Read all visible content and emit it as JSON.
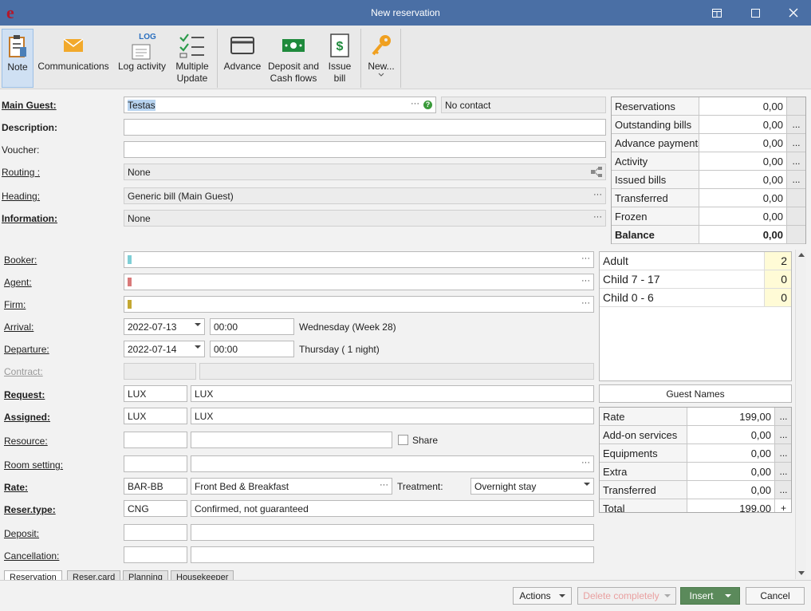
{
  "window": {
    "logo": "e",
    "title": "New reservation"
  },
  "ribbon": {
    "note": "Note",
    "communications": "Communications",
    "log_text": "LOG",
    "log_activity": "Log activity",
    "multiple_update_1": "Multiple",
    "multiple_update_2": "Update",
    "advance": "Advance",
    "deposit_1": "Deposit and",
    "deposit_2": "Cash flows",
    "issue_1": "Issue",
    "issue_2": "bill",
    "new": "New..."
  },
  "labels": {
    "main_guest": "Main Guest:",
    "description": "Description:",
    "voucher": "Voucher:",
    "routing": "Routing :",
    "heading": "Heading:",
    "information": "Information:",
    "booker": "Booker:",
    "agent": "Agent:",
    "firm": "Firm:",
    "arrival": "Arrival:",
    "departure": "Departure:",
    "contract": "Contract:",
    "request": "Request:",
    "assigned": "Assigned:",
    "resource": "Resource:",
    "room_setting": "Room setting:",
    "rate": "Rate:",
    "reser_type": "Reser.type:",
    "deposit": "Deposit:",
    "cancellation": "Cancellation:",
    "share": "Share",
    "treatment": "Treatment:"
  },
  "fields": {
    "main_guest": "Testas",
    "no_contact": "No contact",
    "routing": "None",
    "heading": "Generic bill (Main Guest)",
    "information": "None",
    "arrival_date": "2022-07-13",
    "arrival_time": "00:00",
    "arrival_info": "Wednesday (Week 28)",
    "departure_date": "2022-07-14",
    "departure_time": "00:00",
    "departure_info": "Thursday ( 1 night)",
    "request_code": "LUX",
    "request_name": "LUX",
    "assigned_code": "LUX",
    "assigned_name": "LUX",
    "rate_code": "BAR-BB",
    "rate_name": "Front Bed & Breakfast",
    "treatment": "Overnight stay",
    "reser_type_code": "CNG",
    "reser_type_name": "Confirmed, not guaranteed",
    "dots": "···",
    "ellipsis": "..."
  },
  "colors": {
    "booker": "#7fcfd6",
    "agent": "#d97a7a",
    "firm": "#c4a832",
    "accent": "#4a6fa5",
    "insert": "#5b8a5b"
  },
  "balance": [
    {
      "label": "Reservations",
      "value": "0,00",
      "btn": ""
    },
    {
      "label": "Outstanding bills",
      "value": "0,00",
      "btn": "..."
    },
    {
      "label": "Advance payments",
      "value": "0,00",
      "btn": "..."
    },
    {
      "label": "Activity",
      "value": "0,00",
      "btn": "..."
    },
    {
      "label": "Issued bills",
      "value": "0,00",
      "btn": "..."
    },
    {
      "label": "Transferred",
      "value": "0,00",
      "btn": ""
    },
    {
      "label": "Frozen",
      "value": "0,00",
      "btn": ""
    },
    {
      "label": "Balance",
      "value": "0,00",
      "btn": ""
    }
  ],
  "occupancy": [
    {
      "label": "Adult",
      "value": "2"
    },
    {
      "label": "Child 7 - 17",
      "value": "0"
    },
    {
      "label": "Child 0 - 6",
      "value": "0"
    }
  ],
  "guest_names": "Guest Names",
  "rates": [
    {
      "label": "Rate",
      "value": "199,00"
    },
    {
      "label": "Add-on services",
      "value": "0,00"
    },
    {
      "label": "Equipments",
      "value": "0,00"
    },
    {
      "label": "Extra",
      "value": "0,00"
    },
    {
      "label": "Transferred",
      "value": "0,00"
    },
    {
      "label": "Total",
      "value": "199,00"
    }
  ],
  "tabs": [
    "Reservation",
    "Reser.card",
    "Planning",
    "Housekeeper"
  ],
  "buttons": {
    "actions": "Actions",
    "delete": "Delete completely",
    "insert": "Insert",
    "cancel": "Cancel"
  }
}
